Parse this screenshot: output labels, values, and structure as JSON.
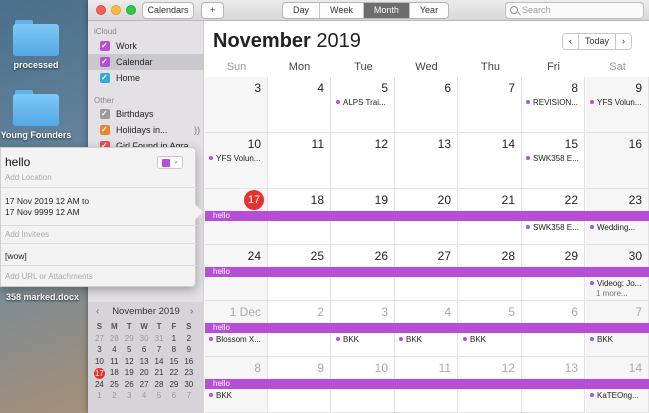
{
  "desktop": {
    "icons": [
      {
        "label": "processed"
      },
      {
        "label": "Young Founders"
      }
    ],
    "file_label": "358 marked.docx"
  },
  "toolbar": {
    "calendars_label": "Calendars",
    "add_label": "+",
    "views": [
      "Day",
      "Week",
      "Month",
      "Year"
    ],
    "active_view": "Month",
    "search_placeholder": "Search"
  },
  "sidebar": {
    "sections": [
      {
        "title": "iCloud",
        "items": [
          {
            "label": "Work",
            "color": "#b64ed8",
            "selected": false
          },
          {
            "label": "Calendar",
            "color": "#b64ed8",
            "selected": true
          },
          {
            "label": "Home",
            "color": "#37a9db",
            "selected": false
          }
        ]
      },
      {
        "title": "Other",
        "items": [
          {
            "label": "Birthdays",
            "color": "#9b9b9b",
            "selected": false
          },
          {
            "label": "Holidays in...",
            "color": "#e6872c",
            "selected": false
          },
          {
            "label": "Girl Found in Agra",
            "color": "#e05252",
            "selected": false
          }
        ]
      }
    ]
  },
  "mini_calendar": {
    "title": "November 2019",
    "prev": "‹",
    "next": "›",
    "weekdays": [
      "S",
      "M",
      "T",
      "W",
      "T",
      "F",
      "S"
    ],
    "weeks": [
      [
        "27",
        "28",
        "29",
        "30",
        "31",
        "1",
        "2"
      ],
      [
        "3",
        "4",
        "5",
        "6",
        "7",
        "8",
        "9"
      ],
      [
        "10",
        "11",
        "12",
        "13",
        "14",
        "15",
        "16"
      ],
      [
        "17",
        "18",
        "19",
        "20",
        "21",
        "22",
        "23"
      ],
      [
        "24",
        "25",
        "26",
        "27",
        "28",
        "29",
        "30"
      ],
      [
        "1",
        "2",
        "3",
        "4",
        "5",
        "6",
        "7"
      ]
    ],
    "today": "17"
  },
  "main": {
    "title_month": "November",
    "title_year": "2019",
    "nav": {
      "prev": "‹",
      "today": "Today",
      "next": "›"
    },
    "weekdays": [
      "Sun",
      "Mon",
      "Tue",
      "Wed",
      "Thu",
      "Fri",
      "Sat"
    ],
    "weeks": [
      {
        "days": [
          {
            "num": "3",
            "dim": false,
            "events": []
          },
          {
            "num": "4",
            "dim": false,
            "events": []
          },
          {
            "num": "5",
            "dim": false,
            "events": [
              "ALPS Trai..."
            ]
          },
          {
            "num": "6",
            "dim": false,
            "events": []
          },
          {
            "num": "7",
            "dim": false,
            "events": []
          },
          {
            "num": "8",
            "dim": false,
            "events": [
              "REVISION..."
            ]
          },
          {
            "num": "9",
            "dim": false,
            "events": [
              "YFS Volun..."
            ]
          }
        ]
      },
      {
        "days": [
          {
            "num": "10",
            "dim": false,
            "events": [
              "YFS Volun..."
            ]
          },
          {
            "num": "11",
            "dim": false,
            "events": []
          },
          {
            "num": "12",
            "dim": false,
            "events": []
          },
          {
            "num": "13",
            "dim": false,
            "events": []
          },
          {
            "num": "14",
            "dim": false,
            "events": []
          },
          {
            "num": "15",
            "dim": false,
            "events": [
              "SWK358 E..."
            ]
          },
          {
            "num": "16",
            "dim": false,
            "events": []
          }
        ]
      },
      {
        "bar": "hello",
        "days": [
          {
            "num": "17",
            "dim": false,
            "today": true,
            "events": []
          },
          {
            "num": "18",
            "dim": false,
            "events": []
          },
          {
            "num": "19",
            "dim": false,
            "events": []
          },
          {
            "num": "20",
            "dim": false,
            "events": []
          },
          {
            "num": "21",
            "dim": false,
            "events": []
          },
          {
            "num": "22",
            "dim": false,
            "events": [
              "SWK358 E..."
            ]
          },
          {
            "num": "23",
            "dim": false,
            "events": [
              "Wedding..."
            ]
          }
        ]
      },
      {
        "bar": "hello",
        "days": [
          {
            "num": "24",
            "dim": false,
            "events": []
          },
          {
            "num": "25",
            "dim": false,
            "events": []
          },
          {
            "num": "26",
            "dim": false,
            "events": []
          },
          {
            "num": "27",
            "dim": false,
            "events": []
          },
          {
            "num": "28",
            "dim": false,
            "events": []
          },
          {
            "num": "29",
            "dim": false,
            "events": []
          },
          {
            "num": "30",
            "dim": false,
            "events": [
              "Videog: Jo..."
            ],
            "more": "1 more..."
          }
        ]
      },
      {
        "bar": "hello",
        "days": [
          {
            "num": "1 Dec",
            "dim": true,
            "events": [
              "Blossom X..."
            ]
          },
          {
            "num": "2",
            "dim": true,
            "events": []
          },
          {
            "num": "3",
            "dim": true,
            "events": [
              "BKK"
            ]
          },
          {
            "num": "4",
            "dim": true,
            "events": [
              "BKK"
            ]
          },
          {
            "num": "5",
            "dim": true,
            "events": [
              "BKK"
            ]
          },
          {
            "num": "6",
            "dim": true,
            "events": []
          },
          {
            "num": "7",
            "dim": true,
            "events": [
              "BKK"
            ]
          }
        ]
      },
      {
        "bar": "hello",
        "days": [
          {
            "num": "8",
            "dim": true,
            "events": [
              "BKK"
            ]
          },
          {
            "num": "9",
            "dim": true,
            "events": []
          },
          {
            "num": "10",
            "dim": true,
            "events": []
          },
          {
            "num": "11",
            "dim": true,
            "events": []
          },
          {
            "num": "12",
            "dim": true,
            "events": []
          },
          {
            "num": "13",
            "dim": true,
            "events": []
          },
          {
            "num": "14",
            "dim": true,
            "events": [
              "KaTEOng..."
            ]
          }
        ]
      }
    ]
  },
  "popover": {
    "title": "hello",
    "location_placeholder": "Add Location",
    "date_from": "17 Nov 2019 12 AM to",
    "date_to": "17 Nov 9999 12 AM",
    "invitees_placeholder": "Add Invitees",
    "note": "[wow]",
    "url_placeholder": "Add URL or Attachments",
    "color": "#b64ed8"
  },
  "colors": {
    "accent": "#b64ed8",
    "today": "#e5322f"
  }
}
